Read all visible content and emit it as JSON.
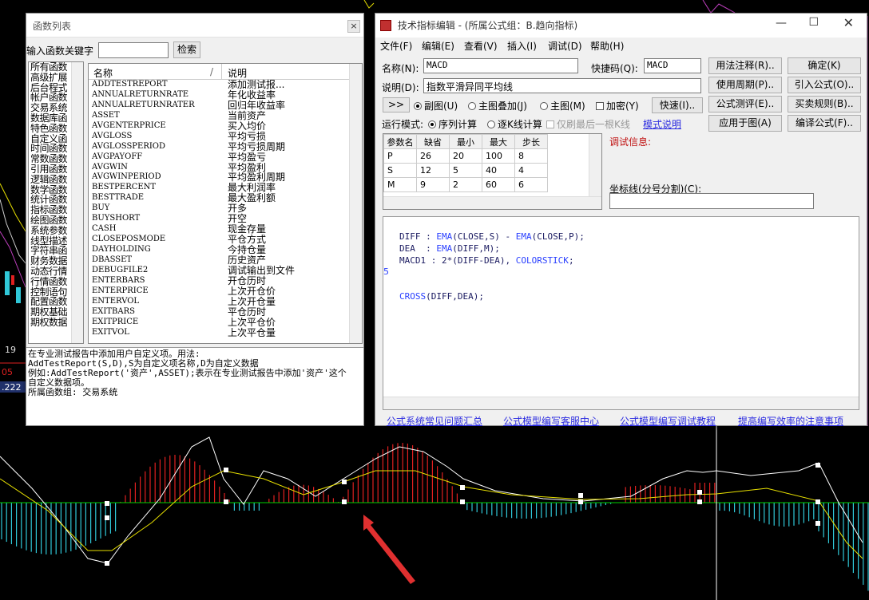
{
  "chart_bg": {
    "left_labels": [
      "19",
      "05",
      ".222"
    ]
  },
  "fn_window": {
    "title": "函数列表",
    "close": "×",
    "search_label": "输入函数关键字",
    "search_value": "",
    "search_button": "检索",
    "categories": [
      "所有函数",
      "高级扩展",
      "后台程式",
      "帐户函数",
      "交易系统",
      "数据库函",
      "特色函数",
      "自定义函",
      "时间函数",
      "常数函数",
      "引用函数",
      "逻辑函数",
      "数学函数",
      "统计函数",
      "指标函数",
      "绘图函数",
      "系统参数",
      "线型描述",
      "字符串函",
      "财务数据",
      "动态行情",
      "行情函数",
      "控制语句",
      "配置函数",
      "期权基础",
      "期权数据"
    ],
    "col_name": "名称",
    "col_desc": "说明",
    "functions": [
      {
        "n": "ADDTESTREPORT",
        "d": "添加测试报..."
      },
      {
        "n": "ANNUALRETURNRATE",
        "d": "年化收益率"
      },
      {
        "n": "ANNUALRETURNRATER",
        "d": "回归年收益率"
      },
      {
        "n": "ASSET",
        "d": "当前资产"
      },
      {
        "n": "AVGENTERPRICE",
        "d": "买入均价"
      },
      {
        "n": "AVGLOSS",
        "d": "平均亏损"
      },
      {
        "n": "AVGLOSSPERIOD",
        "d": "平均亏损周期"
      },
      {
        "n": "AVGPAYOFF",
        "d": "平均盈亏"
      },
      {
        "n": "AVGWIN",
        "d": "平均盈利"
      },
      {
        "n": "AVGWINPERIOD",
        "d": "平均盈利周期"
      },
      {
        "n": "BESTPERCENT",
        "d": "最大利润率"
      },
      {
        "n": "BESTTRADE",
        "d": "最大盈利额"
      },
      {
        "n": "BUY",
        "d": "开多"
      },
      {
        "n": "BUYSHORT",
        "d": "开空"
      },
      {
        "n": "CASH",
        "d": "现金存量"
      },
      {
        "n": "CLOSEPOSMODE",
        "d": "平仓方式"
      },
      {
        "n": "DAYHOLDING",
        "d": "今持仓量"
      },
      {
        "n": "DBASSET",
        "d": "历史资产"
      },
      {
        "n": "DEBUGFILE2",
        "d": "调试输出到文件"
      },
      {
        "n": "ENTERBARS",
        "d": "开仓历时"
      },
      {
        "n": "ENTERPRICE",
        "d": "上次开仓价"
      },
      {
        "n": "ENTERVOL",
        "d": "上次开仓量"
      },
      {
        "n": "EXITBARS",
        "d": "平仓历时"
      },
      {
        "n": "EXITPRICE",
        "d": "上次平仓价"
      },
      {
        "n": "EXITVOL",
        "d": "上次平仓量"
      }
    ],
    "desc_lines": [
      "在专业测试报告中添加用户自定义项。用法:",
      "AddTestReport(S,D),S为自定义项名称,D为自定义数据",
      "例如:AddTestReport('资产',ASSET);表示在专业测试报告中添加'资产'这个",
      "自定义数据项。",
      "所属函数组: 交易系统"
    ]
  },
  "ed_window": {
    "title": "技术指标编辑 - (所属公式组：B.趋向指标)",
    "menus": [
      "文件(F)",
      "编辑(E)",
      "查看(V)",
      "插入(I)",
      "调试(D)",
      "帮助(H)"
    ],
    "name_label": "名称(N):",
    "name_value": "MACD",
    "short_label": "快捷码(Q):",
    "short_value": "MACD",
    "desc_label": "说明(D):",
    "desc_value": "指数平滑异同平均线",
    "expand_btn": ">>",
    "radio_sub": "副图(U)",
    "radio_overlay": "主图叠加(J)",
    "radio_main": "主图(M)",
    "encrypt": "加密(Y)",
    "fast_btn": "快速(I)..",
    "run_mode_label": "运行模式:",
    "run_seq": "序列计算",
    "run_tick": "逐K线计算",
    "last_only": "仅刷最后一根K线",
    "mode_help": "模式说明",
    "buttons": [
      "用法注释(R)..",
      "确定(K)",
      "使用周期(P)..",
      "引入公式(O)..",
      "公式测评(E)..",
      "买卖规则(B)..",
      "应用于图(A)",
      "编译公式(F).."
    ],
    "param_headers": [
      "参数名",
      "缺省",
      "最小",
      "最大",
      "步长"
    ],
    "params": [
      [
        "P",
        "26",
        "20",
        "100",
        "8"
      ],
      [
        "S",
        "12",
        "5",
        "40",
        "4"
      ],
      [
        "M",
        "9",
        "2",
        "60",
        "6"
      ]
    ],
    "debug_label": "调试信息:",
    "coord_label": "坐标线(分号分割)(C):",
    "code_lines": [
      "DIFF : EMA(CLOSE,S) - EMA(CLOSE,P);",
      "DEA  : EMA(DIFF,M);",
      "MACD1 : 2*(DIFF-DEA), COLORSTICK;",
      "",
      "",
      "CROSS(DIFF,DEA);"
    ],
    "line_marker": "5",
    "links": [
      "公式系统常见问题汇总",
      "公式模型编写客服中心",
      "公式模型编写调试教程",
      "提高编写效率的注意事项"
    ]
  },
  "colors": {
    "up_bar": "#e02020",
    "down_bar": "#30c8d8",
    "zero_line": "#00d000",
    "diff_line": "#ffffff",
    "dea_line": "#e8e000",
    "arrow": "#e03030"
  }
}
